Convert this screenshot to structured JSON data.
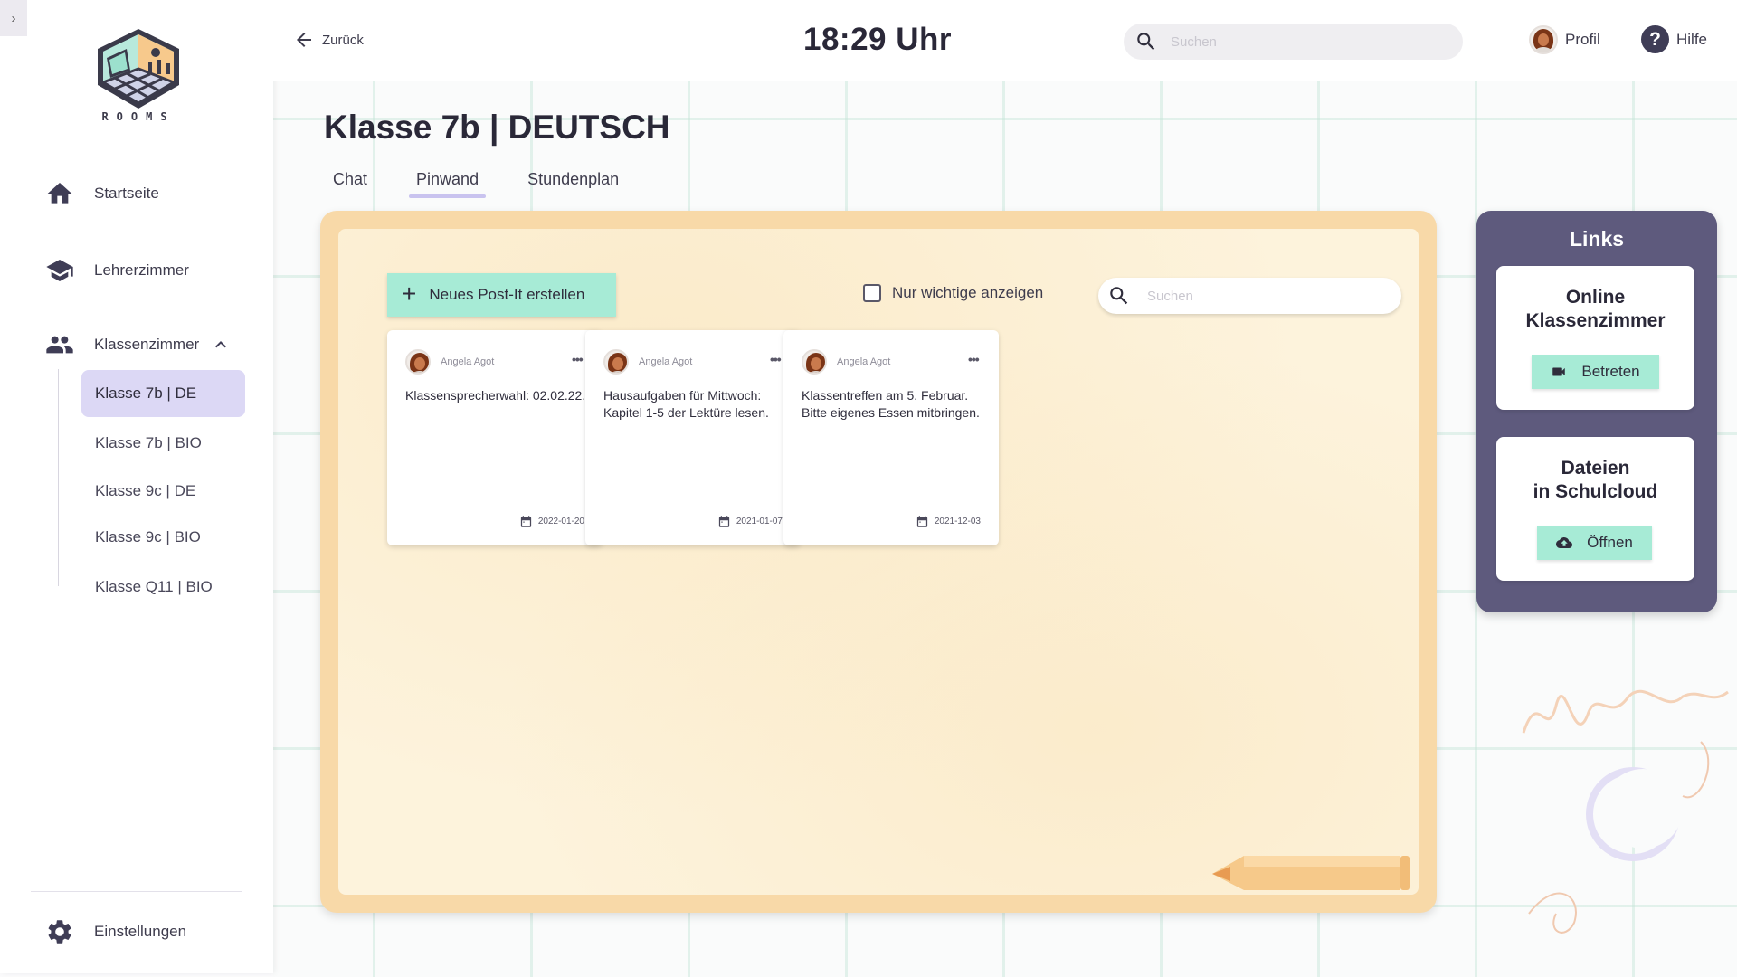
{
  "app": {
    "logo_text": "ROOMS"
  },
  "sidebar": {
    "items": [
      {
        "label": "Startseite",
        "icon": "home-icon"
      },
      {
        "label": "Lehrerzimmer",
        "icon": "school-icon"
      },
      {
        "label": "Klassenzimmer",
        "icon": "people-icon"
      }
    ],
    "subitems": [
      {
        "label": "Klasse 7b | DE",
        "active": true
      },
      {
        "label": "Klasse 7b | BIO",
        "active": false
      },
      {
        "label": "Klasse 9c | DE",
        "active": false
      },
      {
        "label": "Klasse 9c | BIO",
        "active": false
      },
      {
        "label": "Klasse Q11 | BIO",
        "active": false
      }
    ],
    "settings_label": "Einstellungen"
  },
  "header": {
    "back_label": "Zurück",
    "clock": "18:29 Uhr",
    "search_placeholder": "Suchen",
    "profile_label": "Profil",
    "help_label": "Hilfe"
  },
  "main": {
    "title": "Klasse 7b | DEUTSCH",
    "tabs": [
      {
        "label": "Chat",
        "active": false
      },
      {
        "label": "Pinwand",
        "active": true
      },
      {
        "label": "Stundenplan",
        "active": false
      }
    ],
    "board": {
      "new_postit_label": "Neues Post-It erstellen",
      "filter_label": "Nur wichtige anzeigen",
      "filter_checked": false,
      "search_placeholder": "Suchen",
      "postits": [
        {
          "author": "Angela Agot",
          "text": "Klassensprecherwahl: 02.02.22.",
          "date": "2022-01-20"
        },
        {
          "author": "Angela Agot",
          "text": "Hausaufgaben für Mittwoch: Kapitel 1-5 der Lektüre lesen.",
          "date": "2021-01-07"
        },
        {
          "author": "Angela Agot",
          "text": "Klassentreffen am 5. Februar. Bitte eigenes Essen mitbringen.",
          "date": "2021-12-03"
        }
      ]
    }
  },
  "links_panel": {
    "title": "Links",
    "cards": [
      {
        "title_line1": "Online",
        "title_line2": "Klassenzimmer",
        "button_label": "Betreten",
        "button_icon": "video-icon"
      },
      {
        "title_line1": "Dateien",
        "title_line2": "in Schulcloud",
        "button_label": "Öffnen",
        "button_icon": "cloud-upload-icon"
      }
    ]
  },
  "colors": {
    "accent_mint": "#a7ebd6",
    "active_lavender": "#dcd8f5",
    "panel_purple": "#5e5a7d",
    "board_frame": "#f8d9a8",
    "board_paper": "#fdf3dc"
  }
}
